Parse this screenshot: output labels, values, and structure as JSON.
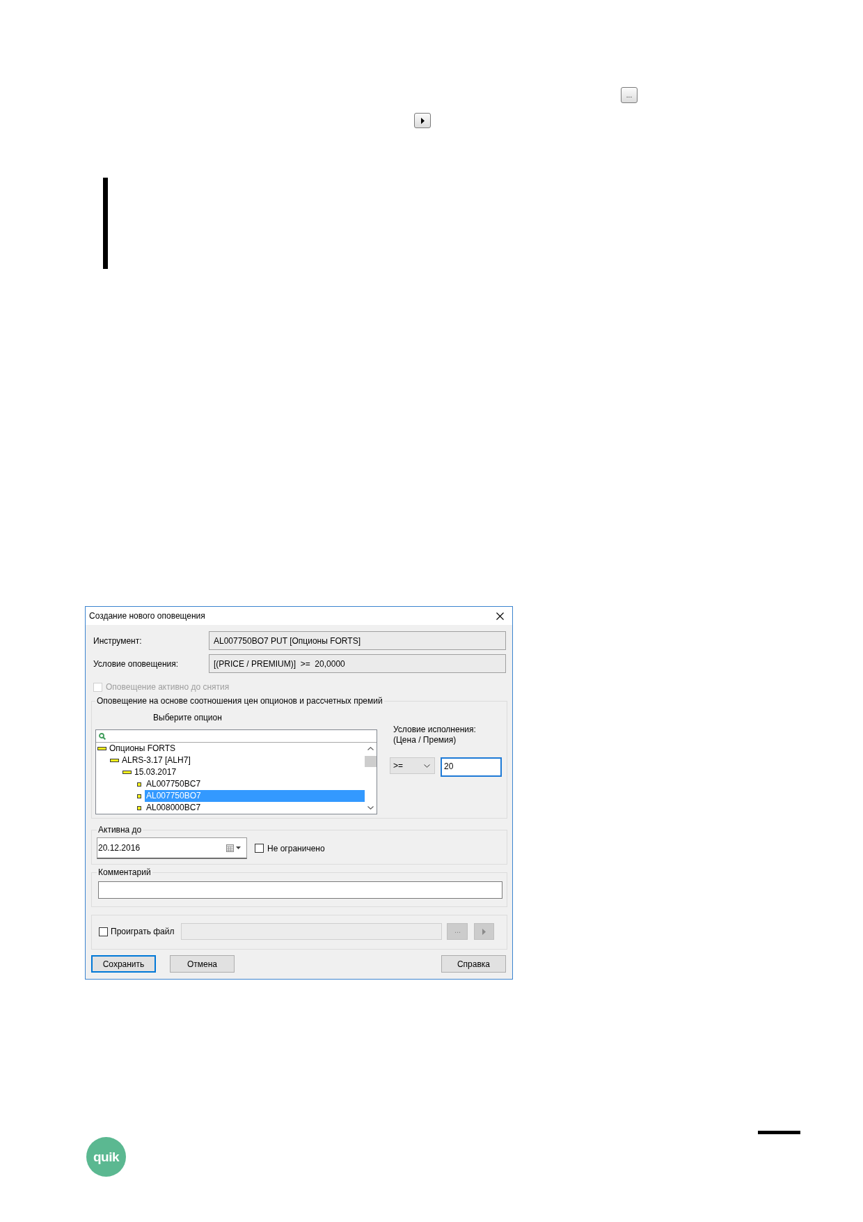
{
  "top_button": {
    "label": "..."
  },
  "dialog": {
    "title": "Создание нового оповещения",
    "fields": [
      {
        "label": "Инструмент:",
        "value": "AL007750BO7 PUT [Опционы FORTS]"
      },
      {
        "label": "Условие оповещения:",
        "value": "[(PRICE / PREMIUM)]  >=  20,0000"
      }
    ],
    "active_until_removed": {
      "label": "Оповещение активно до снятия",
      "checked": false,
      "disabled": true
    },
    "option_group": {
      "title": "Оповещение на основе соотношения цен опционов и рассчетных премий",
      "tree_caption": "Выберите опцион",
      "tree": [
        {
          "label": "Опционы FORTS",
          "selected": false,
          "expanded": true,
          "children": [
            {
              "label": "ALRS-3.17 [ALH7]",
              "selected": false,
              "expanded": true,
              "children": [
                {
                  "label": "15.03.2017",
                  "selected": false,
                  "expanded": true,
                  "children": [
                    {
                      "label": "AL007750BC7",
                      "selected": false
                    },
                    {
                      "label": "AL007750BO7",
                      "selected": true
                    },
                    {
                      "label": "AL008000BC7",
                      "selected": false
                    }
                  ]
                }
              ]
            }
          ]
        }
      ],
      "condition_caption": [
        "Условие исполнения:",
        "(Цена / Премия)"
      ],
      "operator": ">=",
      "threshold": {
        "value": "20",
        "focused": true
      }
    },
    "expiry": {
      "title": "Активна до",
      "date": "20.12.2016",
      "unlimited": {
        "label": "Не ограничено",
        "checked": false
      }
    },
    "comment": {
      "title": "Комментарий"
    },
    "play_file": {
      "label": "Проиграть файл",
      "checked": false,
      "disabled": true,
      "browse_label": "..."
    },
    "buttons": [
      {
        "label": "Сохранить",
        "default": true
      },
      {
        "label": "Отмена",
        "default": false
      },
      {
        "label": "Справка",
        "default": false
      }
    ]
  },
  "logo": {
    "text": "quik"
  }
}
